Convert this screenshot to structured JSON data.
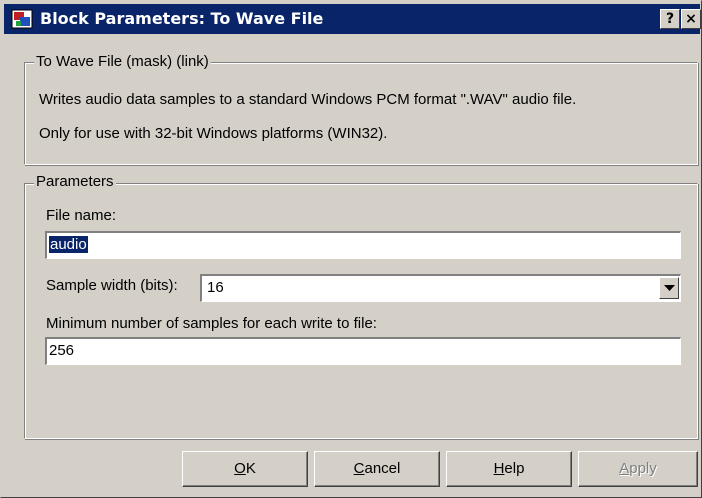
{
  "window": {
    "title": "Block Parameters: To Wave File",
    "help_glyph": "?",
    "close_glyph": "×",
    "icon": "simulink-block-icon"
  },
  "description": {
    "legend": "To Wave File (mask) (link)",
    "line1": "Writes audio data samples to a standard Windows PCM format \".WAV\" audio file.",
    "line2": "Only for use with 32-bit Windows platforms (WIN32)."
  },
  "parameters": {
    "legend": "Parameters",
    "file_name_label": "File name:",
    "file_name_value": "audio",
    "sample_width_label": "Sample width (bits):",
    "sample_width_value": "16",
    "min_samples_label": "Minimum number of samples for each write to file:",
    "min_samples_value": "256"
  },
  "buttons": {
    "ok": {
      "mnemonic": "O",
      "rest": "K"
    },
    "cancel": {
      "mnemonic": "C",
      "rest": "ancel"
    },
    "help": {
      "mnemonic": "H",
      "rest": "elp"
    },
    "apply": {
      "mnemonic": "A",
      "rest": "pply"
    }
  },
  "colors": {
    "titlebar": "#0a246a",
    "face": "#d4d0c8",
    "selection": "#0a246a"
  }
}
